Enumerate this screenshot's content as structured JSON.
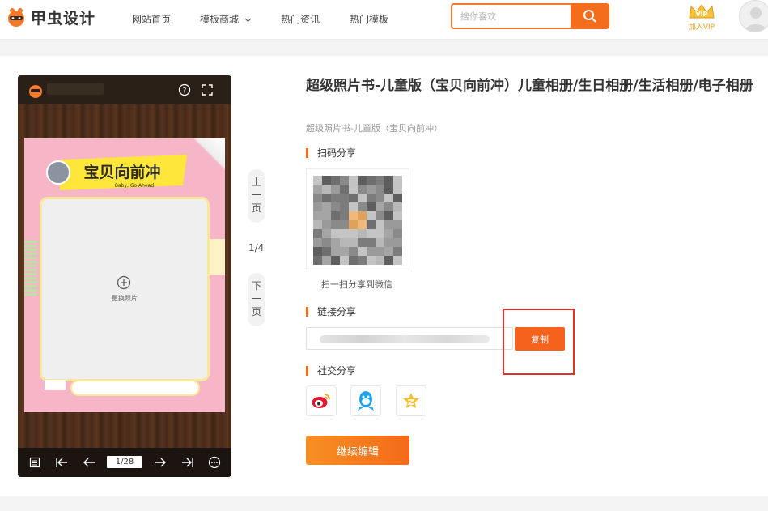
{
  "header": {
    "logo_text": "甲虫设计",
    "nav": [
      "网站首页",
      "模板商城",
      "热门资讯",
      "热门模板"
    ],
    "search_placeholder": "搜你喜欢",
    "vip_label": "加入VIP"
  },
  "viewer": {
    "page_indicator": "1/28",
    "change_photo_label": "更换照片",
    "banner_text": "宝贝向前冲",
    "banner_sub": "Baby, Go Ahead"
  },
  "pager": {
    "prev_label": "上一页",
    "next_label": "下一页",
    "page_count": "1/4"
  },
  "product": {
    "title": "超级照片书-儿童版（宝贝向前冲）儿童相册/生日相册/生活相册/电子相册",
    "subtitle": "超级照片书-儿童版（宝贝向前冲）"
  },
  "share": {
    "qr_section": "扫码分享",
    "qr_caption": "扫一扫分享到微信",
    "link_section": "链接分享",
    "copy_label": "复制",
    "social_section": "社交分享"
  },
  "actions": {
    "continue_edit": "继续编辑"
  },
  "colors": {
    "accent": "#f46d1c",
    "highlight": "#e0302b"
  }
}
